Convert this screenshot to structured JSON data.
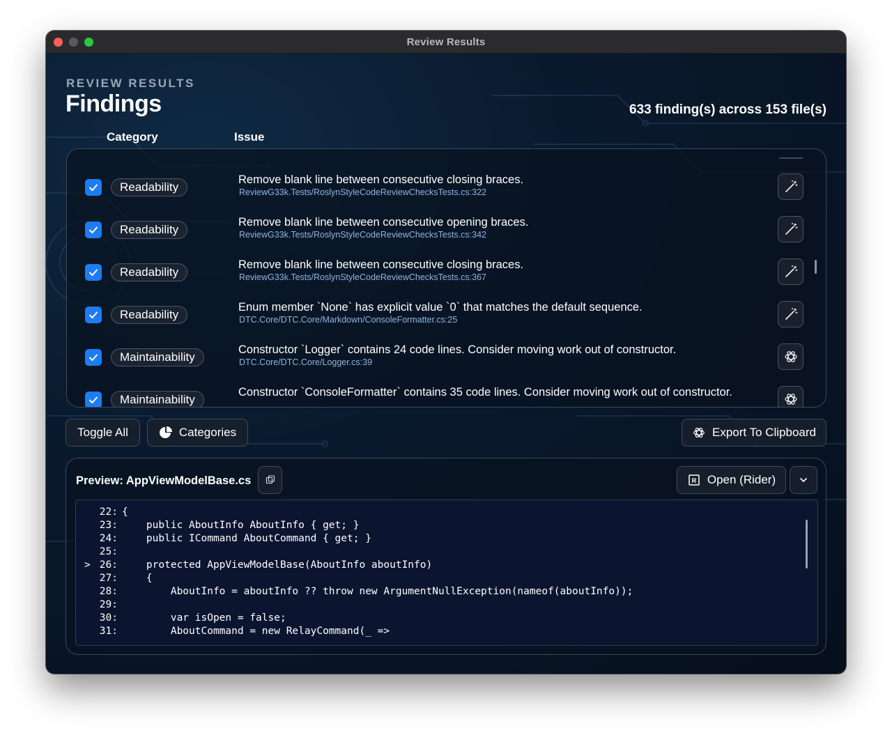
{
  "window": {
    "title": "Review Results"
  },
  "header": {
    "eyebrow": "REVIEW RESULTS",
    "title": "Findings",
    "summary": "633 finding(s) across 153 file(s)"
  },
  "columns": {
    "category": "Category",
    "issue": "Issue"
  },
  "findings": [
    {
      "category": "Readability",
      "title": "Remove blank line between consecutive closing braces.",
      "path": "ReviewG33k.Tests/RoslynStyleCodeReviewChecksTests.cs:322",
      "action_icon": "magic-wand-icon",
      "checked": true
    },
    {
      "category": "Readability",
      "title": "Remove blank line between consecutive opening braces.",
      "path": "ReviewG33k.Tests/RoslynStyleCodeReviewChecksTests.cs:342",
      "action_icon": "magic-wand-icon",
      "checked": true
    },
    {
      "category": "Readability",
      "title": "Remove blank line between consecutive closing braces.",
      "path": "ReviewG33k.Tests/RoslynStyleCodeReviewChecksTests.cs:367",
      "action_icon": "magic-wand-icon",
      "checked": true
    },
    {
      "category": "Readability",
      "title": "Enum member `None` has explicit value `0` that matches the default sequence.",
      "path": "DTC.Core/DTC.Core/Markdown/ConsoleFormatter.cs:25",
      "action_icon": "magic-wand-icon",
      "checked": true
    },
    {
      "category": "Maintainability",
      "title": "Constructor `Logger` contains 24 code lines. Consider moving work out of constructor.",
      "path": "DTC.Core/DTC.Core/Logger.cs:39",
      "action_icon": "openai-icon",
      "checked": true
    },
    {
      "category": "Maintainability",
      "title": "Constructor `ConsoleFormatter` contains 35 code lines. Consider moving work out of constructor.",
      "path": "",
      "action_icon": "openai-icon",
      "checked": true
    }
  ],
  "toolbar": {
    "toggle_all": "Toggle All",
    "categories": "Categories",
    "export": "Export To Clipboard"
  },
  "preview": {
    "title": "Preview: AppViewModelBase.cs",
    "open_label": "Open (Rider)",
    "highlighted_line": "26",
    "lines": [
      {
        "marker": "",
        "num": "22:",
        "text": "{"
      },
      {
        "marker": "",
        "num": "23:",
        "text": "    public AboutInfo AboutInfo { get; }"
      },
      {
        "marker": "",
        "num": "24:",
        "text": "    public ICommand AboutCommand { get; }"
      },
      {
        "marker": "",
        "num": "25:",
        "text": ""
      },
      {
        "marker": ">",
        "num": "26:",
        "text": "    protected AppViewModelBase(AboutInfo aboutInfo)"
      },
      {
        "marker": "",
        "num": "27:",
        "text": "    {"
      },
      {
        "marker": "",
        "num": "28:",
        "text": "        AboutInfo = aboutInfo ?? throw new ArgumentNullException(nameof(aboutInfo));"
      },
      {
        "marker": "",
        "num": "29:",
        "text": ""
      },
      {
        "marker": "",
        "num": "30:",
        "text": "        var isOpen = false;"
      },
      {
        "marker": "",
        "num": "31:",
        "text": "        AboutCommand = new RelayCommand(_ =>"
      }
    ]
  },
  "colors": {
    "accent": "#1e7cf2",
    "path_text": "#8fb4e0",
    "background": "#0a1a2e"
  }
}
